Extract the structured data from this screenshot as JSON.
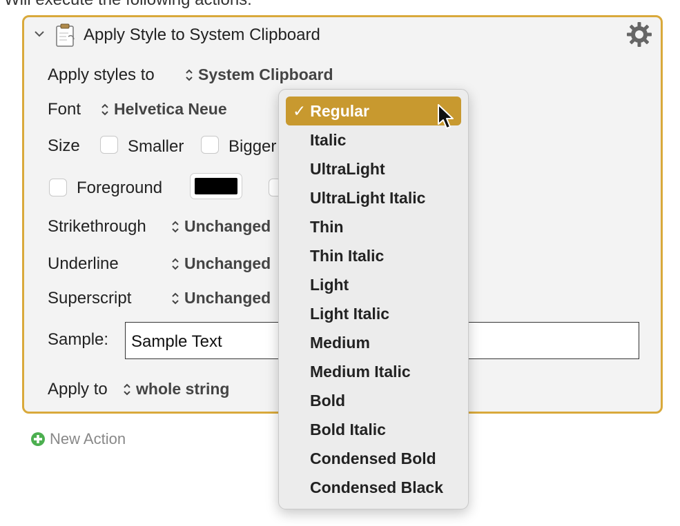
{
  "header_text": "Will execute the following actions:",
  "action": {
    "title": "Apply Style to System Clipboard",
    "apply_styles_label": "Apply styles to",
    "apply_styles_value": "System Clipboard",
    "font_label": "Font",
    "font_value": "Helvetica Neue",
    "size_label": "Size",
    "smaller_label": "Smaller",
    "bigger_label": "Bigger",
    "foreground_label": "Foreground",
    "strikethrough_label": "Strikethrough",
    "strikethrough_value": "Unchanged",
    "underline_label": "Underline",
    "underline_value": "Unchanged",
    "superscript_label": "Superscript",
    "superscript_value": "Unchanged",
    "sample_label": "Sample:",
    "sample_value": "Sample Text",
    "apply_to_label": "Apply to",
    "apply_to_value": "whole string",
    "foreground_color": "#000000"
  },
  "new_action_label": "New Action",
  "font_style_menu": {
    "items": [
      {
        "label": "Regular",
        "selected": true
      },
      {
        "label": "Italic"
      },
      {
        "label": "UltraLight"
      },
      {
        "label": "UltraLight Italic"
      },
      {
        "label": "Thin"
      },
      {
        "label": "Thin Italic"
      },
      {
        "label": "Light"
      },
      {
        "label": "Light Italic"
      },
      {
        "label": "Medium"
      },
      {
        "label": "Medium Italic"
      },
      {
        "label": "Bold"
      },
      {
        "label": "Bold Italic"
      },
      {
        "label": "Condensed Bold"
      },
      {
        "label": "Condensed Black"
      }
    ],
    "check_mark": "✓"
  },
  "colors": {
    "accent_border": "#d9a93b",
    "menu_highlight": "#c8992f",
    "new_action_icon": "#4caf50"
  }
}
